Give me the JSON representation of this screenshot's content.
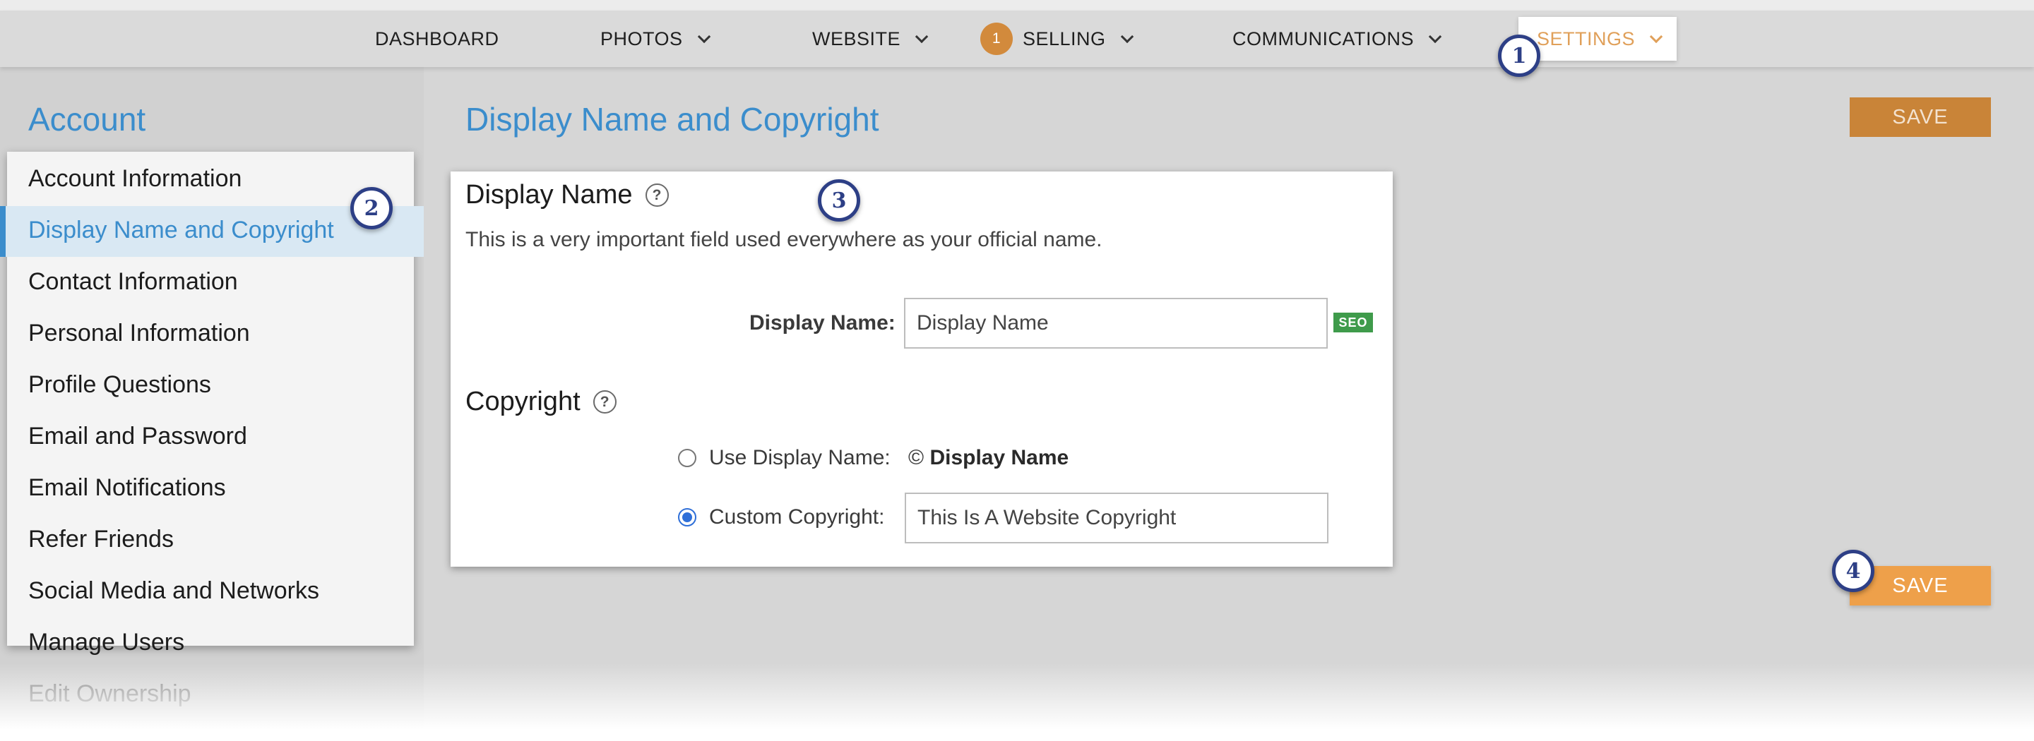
{
  "nav": {
    "items": [
      {
        "label": "DASHBOARD"
      },
      {
        "label": "PHOTOS"
      },
      {
        "label": "WEBSITE"
      },
      {
        "label": "SELLING",
        "badge": "1"
      },
      {
        "label": "COMMUNICATIONS"
      },
      {
        "label": "SETTINGS"
      }
    ]
  },
  "steps": [
    "1",
    "2",
    "3",
    "4"
  ],
  "sidebar": {
    "title": "Account",
    "items": [
      {
        "label": "Account Information"
      },
      {
        "label": "Display Name and Copyright"
      },
      {
        "label": "Contact Information"
      },
      {
        "label": "Personal Information"
      },
      {
        "label": "Profile Questions"
      },
      {
        "label": "Email and Password"
      },
      {
        "label": "Email Notifications"
      },
      {
        "label": "Refer Friends"
      },
      {
        "label": "Social Media and Networks"
      },
      {
        "label": "Manage Users"
      },
      {
        "label": "Edit Ownership"
      }
    ],
    "active_index": 1
  },
  "main": {
    "title": "Display Name and Copyright",
    "save_label": "SAVE",
    "display_name": {
      "heading": "Display Name",
      "help": "?",
      "description": "This is a very important field used everywhere as your official name.",
      "field_label": "Display Name:",
      "value": "Display Name",
      "seo_badge": "SEO"
    },
    "copyright": {
      "heading": "Copyright",
      "help": "?",
      "use_display_label": "Use Display Name:",
      "copyright_symbol": "©",
      "display_value": "Display Name",
      "custom_label": "Custom Copyright:",
      "custom_value": "This Is A Website Copyright",
      "selected": "custom"
    }
  },
  "colors": {
    "accent_blue": "#3b8dcc",
    "accent_orange": "#eea04a",
    "settings_orange": "#e0a05a",
    "step_navy": "#2d3f86",
    "seo_green": "#3f9b4b"
  }
}
